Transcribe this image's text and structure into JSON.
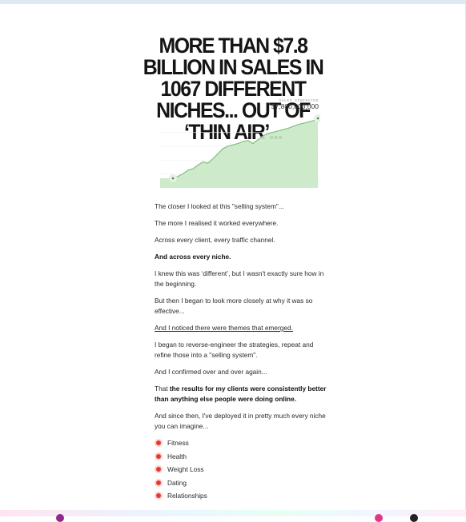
{
  "page": {
    "headline": "More than $7.8 billion in sales in 1067 different niches... out of ‘thin air’..."
  },
  "chart": {
    "caption": "SALES GENERATED",
    "value_label": "$7,800,000,000"
  },
  "chart_data": {
    "type": "area",
    "title": "",
    "series": [
      {
        "values": [
          0.05,
          0.08,
          0.12,
          0.18,
          0.2,
          0.26,
          0.31,
          0.29,
          0.36,
          0.44,
          0.52,
          0.56,
          0.58,
          0.6,
          0.63,
          0.65,
          0.6,
          0.66,
          0.72,
          0.76,
          0.78,
          0.8,
          0.82,
          0.84,
          0.87,
          0.9,
          0.92,
          0.94,
          0.96,
          1.0
        ]
      }
    ],
    "colors": {
      "line": "#7fbf7f",
      "fill": "#c8e8c4",
      "marker": "#e4f2e0"
    }
  },
  "body": {
    "p1": "The closer I looked at this \"selling system\"...",
    "p2": "The more I realised it worked everywhere.",
    "p3": "Across every client, every traffic channel.",
    "p4": "And across every niche.",
    "p5": "I knew this was ‘different’, but I wasn't exactly sure how in the beginning.",
    "p6": "But then I began to look more closely at why it was so effective...",
    "p7": "And I noticed there were themes that emerged.",
    "p8": "I began to reverse-engineer the strategies, repeat and refine those into a \"selling system\".",
    "p9": "And I confirmed over and over again...",
    "p10_prefix": "That ",
    "p10_bold": "the results for my clients were consistently better than anything else people were doing online.",
    "p11": "And since then, I've deployed it in pretty much every niche you can imagine..."
  },
  "niches": [
    "Fitness",
    "Health",
    "Weight Loss",
    "Dating",
    "Relationships"
  ]
}
